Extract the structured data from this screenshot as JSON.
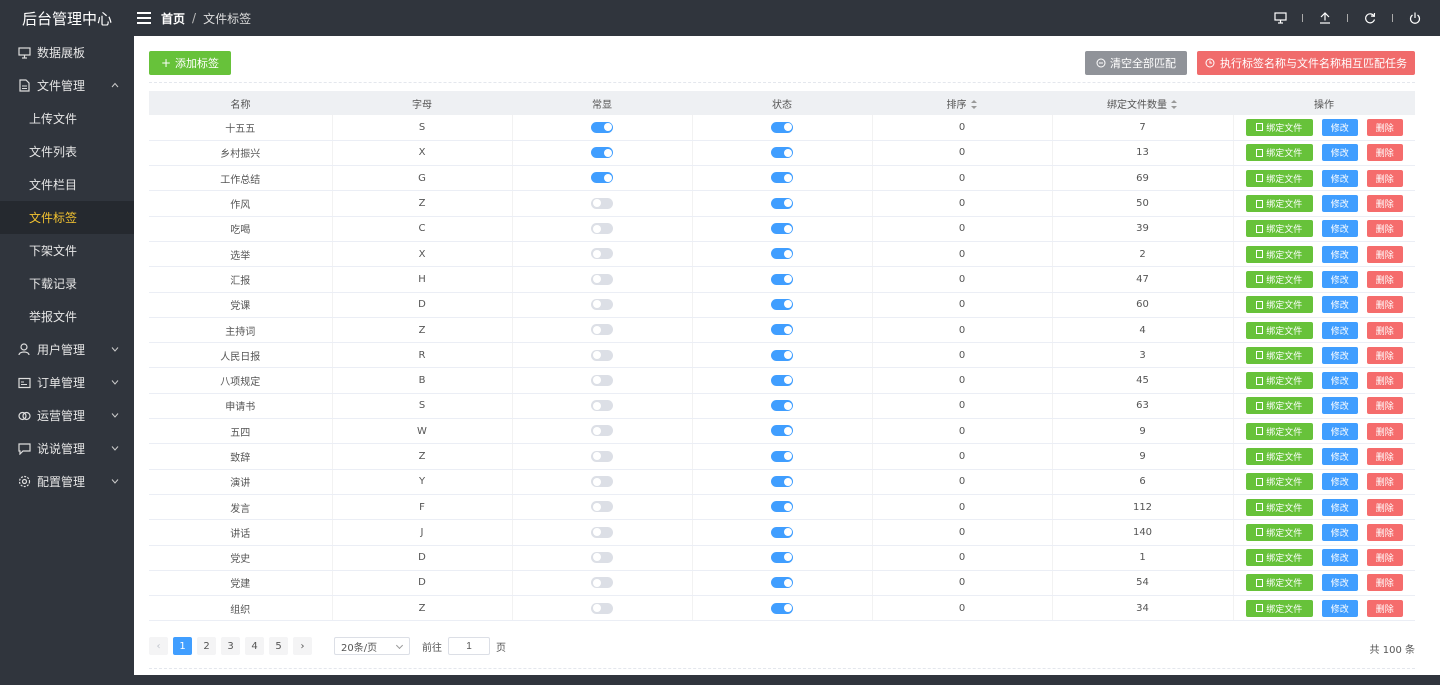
{
  "app": {
    "title": "后台管理中心"
  },
  "breadcrumb": {
    "home": "首页",
    "separator": "/",
    "current": "文件标签"
  },
  "header_icons": [
    "monitor-icon",
    "upload-icon",
    "refresh-icon",
    "power-icon"
  ],
  "sidebar": {
    "items": [
      {
        "label": "数据展板",
        "icon": "monitor-icon"
      },
      {
        "label": "文件管理",
        "icon": "document-icon",
        "expanded": true,
        "children": [
          {
            "label": "上传文件"
          },
          {
            "label": "文件列表"
          },
          {
            "label": "文件栏目"
          },
          {
            "label": "文件标签",
            "active": true
          },
          {
            "label": "下架文件"
          },
          {
            "label": "下载记录"
          },
          {
            "label": "举报文件"
          }
        ]
      },
      {
        "label": "用户管理",
        "icon": "user-icon"
      },
      {
        "label": "订单管理",
        "icon": "order-icon"
      },
      {
        "label": "运营管理",
        "icon": "operation-icon"
      },
      {
        "label": "说说管理",
        "icon": "chat-icon"
      },
      {
        "label": "配置管理",
        "icon": "gear-icon"
      }
    ]
  },
  "toolbar": {
    "add_label": "添加标签",
    "clear_label": "清空全部匹配",
    "exec_label": "执行标签名称与文件名称相互匹配任务"
  },
  "table": {
    "columns": [
      "名称",
      "字母",
      "常显",
      "状态",
      "排序",
      "绑定文件数量",
      "操作"
    ],
    "actions": {
      "bind": "绑定文件",
      "edit": "修改",
      "delete": "删除"
    },
    "rows": [
      {
        "name": "十五五",
        "letter": "S",
        "pinned": true,
        "status": true,
        "order": "0",
        "count": "7"
      },
      {
        "name": "乡村振兴",
        "letter": "X",
        "pinned": true,
        "status": true,
        "order": "0",
        "count": "13"
      },
      {
        "name": "工作总结",
        "letter": "G",
        "pinned": true,
        "status": true,
        "order": "0",
        "count": "69"
      },
      {
        "name": "作风",
        "letter": "Z",
        "pinned": false,
        "status": true,
        "order": "0",
        "count": "50"
      },
      {
        "name": "吃喝",
        "letter": "C",
        "pinned": false,
        "status": true,
        "order": "0",
        "count": "39"
      },
      {
        "name": "选举",
        "letter": "X",
        "pinned": false,
        "status": true,
        "order": "0",
        "count": "2"
      },
      {
        "name": "汇报",
        "letter": "H",
        "pinned": false,
        "status": true,
        "order": "0",
        "count": "47"
      },
      {
        "name": "党课",
        "letter": "D",
        "pinned": false,
        "status": true,
        "order": "0",
        "count": "60"
      },
      {
        "name": "主持词",
        "letter": "Z",
        "pinned": false,
        "status": true,
        "order": "0",
        "count": "4"
      },
      {
        "name": "人民日报",
        "letter": "R",
        "pinned": false,
        "status": true,
        "order": "0",
        "count": "3"
      },
      {
        "name": "八项规定",
        "letter": "B",
        "pinned": false,
        "status": true,
        "order": "0",
        "count": "45"
      },
      {
        "name": "申请书",
        "letter": "S",
        "pinned": false,
        "status": true,
        "order": "0",
        "count": "63"
      },
      {
        "name": "五四",
        "letter": "W",
        "pinned": false,
        "status": true,
        "order": "0",
        "count": "9"
      },
      {
        "name": "致辞",
        "letter": "Z",
        "pinned": false,
        "status": true,
        "order": "0",
        "count": "9"
      },
      {
        "name": "演讲",
        "letter": "Y",
        "pinned": false,
        "status": true,
        "order": "0",
        "count": "6"
      },
      {
        "name": "发言",
        "letter": "F",
        "pinned": false,
        "status": true,
        "order": "0",
        "count": "112"
      },
      {
        "name": "讲话",
        "letter": "J",
        "pinned": false,
        "status": true,
        "order": "0",
        "count": "140"
      },
      {
        "name": "党史",
        "letter": "D",
        "pinned": false,
        "status": true,
        "order": "0",
        "count": "1"
      },
      {
        "name": "党建",
        "letter": "D",
        "pinned": false,
        "status": true,
        "order": "0",
        "count": "54"
      },
      {
        "name": "组织",
        "letter": "Z",
        "pinned": false,
        "status": true,
        "order": "0",
        "count": "34"
      }
    ]
  },
  "pagination": {
    "prev": "‹",
    "next": "›",
    "pages": [
      "1",
      "2",
      "3",
      "4",
      "5"
    ],
    "current": "1",
    "page_size": "20条/页",
    "goto_label": "前往",
    "goto_value": "1",
    "goto_suffix": "页",
    "total": "共 100 条"
  },
  "colors": {
    "primary": "#409eff",
    "success": "#67c23a",
    "danger": "#f56c6c",
    "sidebar": "#30353d",
    "active_text": "#f2c230"
  }
}
